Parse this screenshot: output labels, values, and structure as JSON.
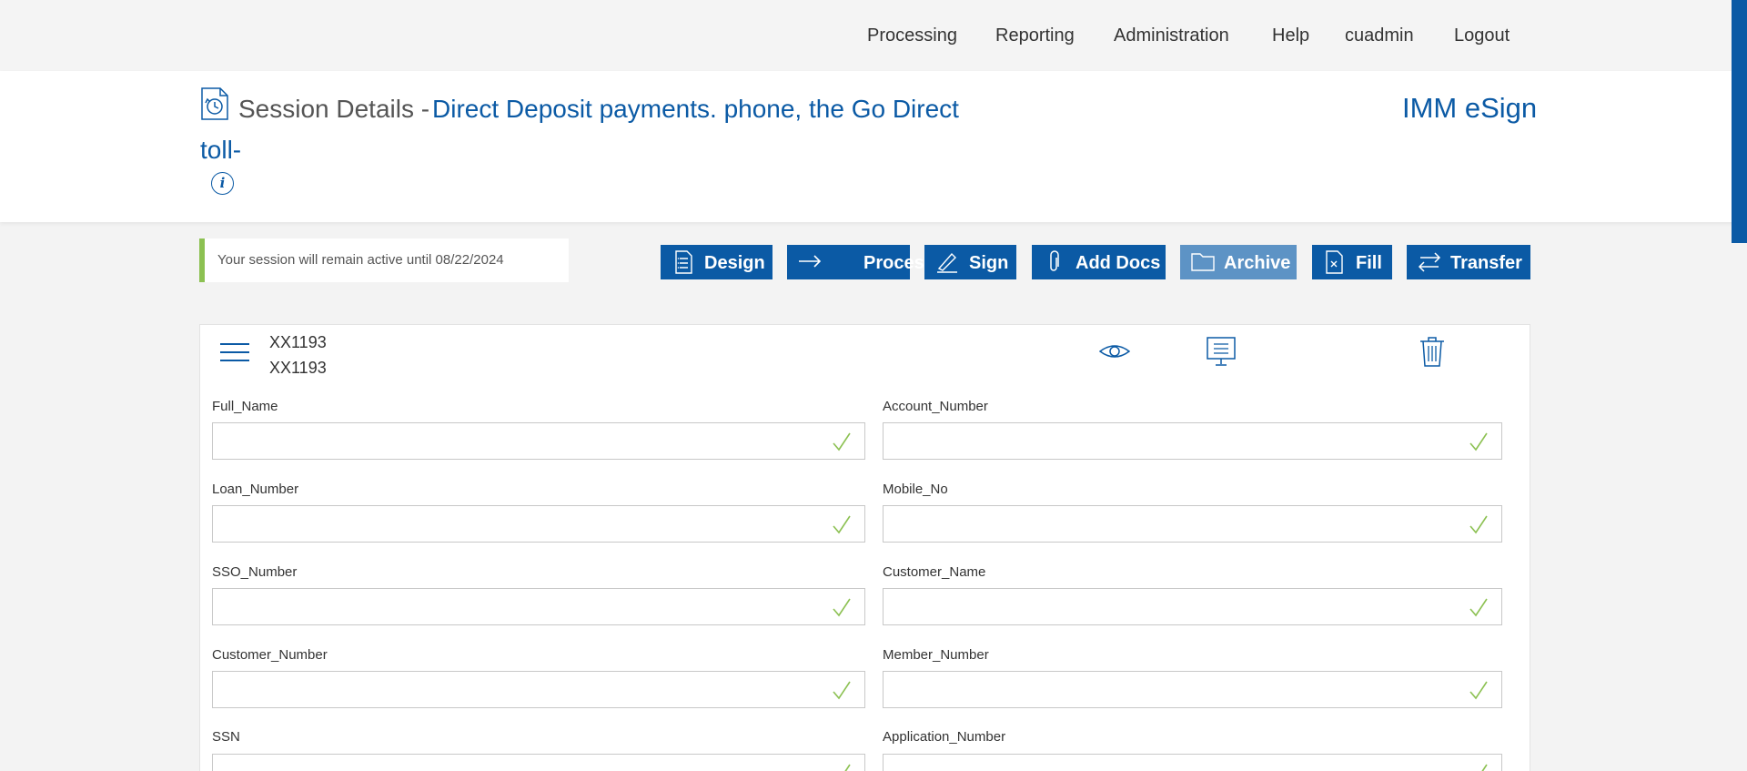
{
  "nav": {
    "items": [
      "Processing",
      "Reporting",
      "Administration",
      "Help",
      "cuadmin",
      "Logout"
    ]
  },
  "header": {
    "session_label": "Session Details -",
    "session_name_line1": "Direct Deposit payments. phone, the Go Direct",
    "session_name_line2": "toll-",
    "info_glyph": "i",
    "brand": "IMM eSign"
  },
  "notice": {
    "text": "Your session will remain active until 08/22/2024",
    "accent": "#8cc152"
  },
  "toolbar": {
    "buttons": [
      {
        "label": "Design",
        "icon": "list-document-icon"
      },
      {
        "label": "Process",
        "icon": "arrow-right-icon"
      },
      {
        "label": "Sign",
        "icon": "signature-pen-icon"
      },
      {
        "label": "Add Docs",
        "icon": "paperclip-icon"
      },
      {
        "label": "Archive",
        "icon": "folder-icon",
        "state": "disabled"
      },
      {
        "label": "Fill",
        "icon": "document-x-icon"
      },
      {
        "label": "Transfer",
        "icon": "swap-arrows-icon"
      }
    ]
  },
  "document": {
    "id_line1": "XX1193",
    "id_line2": "XX1193",
    "actions": [
      "eye-icon",
      "monitor-icon",
      "trash-icon"
    ]
  },
  "fields": [
    {
      "label": "Full_Name",
      "value": ""
    },
    {
      "label": "Account_Number",
      "value": ""
    },
    {
      "label": "Loan_Number",
      "value": ""
    },
    {
      "label": "Mobile_No",
      "value": ""
    },
    {
      "label": "SSO_Number",
      "value": ""
    },
    {
      "label": "Customer_Name",
      "value": ""
    },
    {
      "label": "Customer_Number",
      "value": ""
    },
    {
      "label": "Member_Number",
      "value": ""
    },
    {
      "label": "SSN",
      "value": ""
    },
    {
      "label": "Application_Number",
      "value": ""
    }
  ],
  "colors": {
    "primary": "#0b5aa5",
    "disabled_button": "#5d93c5",
    "check": "#8cc152"
  }
}
